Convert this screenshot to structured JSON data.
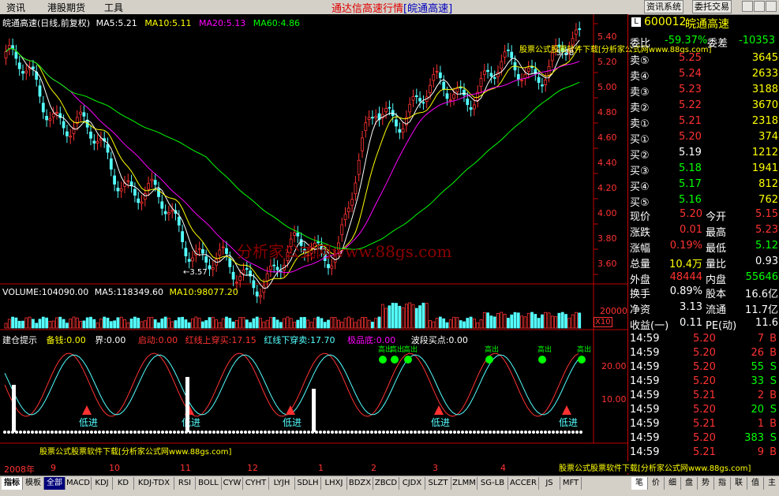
{
  "topbar": {
    "menu": [
      "资讯",
      "港股期货",
      "工具"
    ],
    "title": "通达信高速行情",
    "title_tag": "[皖通高速]",
    "buttons": [
      "资讯系统",
      "委托交易"
    ]
  },
  "main_header": {
    "stock": "皖通高速(日线,前复权)",
    "ma5": "MA5:5.21",
    "ma10": "MA10:5.11",
    "ma20": "MA20:5.13",
    "ma60": "MA60:4.86"
  },
  "price_axis": [
    "5.40",
    "5.20",
    "5.00",
    "4.80",
    "4.60",
    "4.40",
    "4.20",
    "4.00",
    "3.80",
    "3.60"
  ],
  "low_marker": "3.57",
  "high_marker": "5.38",
  "watermark": "分析家公式网www.88gs.com",
  "volume_header": {
    "vol": "VOLUME:104090.00",
    "ma5": "MA5:118349.60",
    "ma10": "MA10:98077.20"
  },
  "volume_axis": [
    "20000",
    "X10"
  ],
  "indicator_header": {
    "label": "建仓提示",
    "beicang": "备钱:0.00",
    "jie": "界:0.00",
    "qidong": "启动:0.00",
    "red_up": "红线上穿买:17.15",
    "red_down": "红线下穿卖:17.70",
    "bottom": "极品底:0.00",
    "wave": "波段买点:0.00"
  },
  "indicator_axis": [
    "20.00",
    "10.00"
  ],
  "indicator_labels": {
    "low_entry": "低进",
    "high_exit": "高出"
  },
  "ad_text_top": "股票公式股票软件下载[分析家公式网www.88gs.com]",
  "ad_text_bottom": "股票公式股票软件下载[分析家公式网www.88gs.com]",
  "ad_text_right": "股票公式股票软件下载[分析家公式网www.88gs.com]",
  "time_axis": [
    "2008年",
    "9",
    "10",
    "11",
    "12",
    "1",
    "2",
    "3",
    "4"
  ],
  "quote": {
    "code": "600012",
    "name": "皖通高速",
    "ratio_label": "委比",
    "ratio_value": "-59.37%",
    "diff_label": "委差",
    "diff_value": "-10353",
    "asks": [
      {
        "label": "卖⑤",
        "price": "5.25",
        "vol": "3645"
      },
      {
        "label": "卖④",
        "price": "5.24",
        "vol": "2633"
      },
      {
        "label": "卖③",
        "price": "5.23",
        "vol": "3188"
      },
      {
        "label": "卖②",
        "price": "5.22",
        "vol": "3670"
      },
      {
        "label": "卖①",
        "price": "5.21",
        "vol": "2318"
      }
    ],
    "bids": [
      {
        "label": "买①",
        "price": "5.20",
        "vol": "374"
      },
      {
        "label": "买②",
        "price": "5.19",
        "vol": "1212"
      },
      {
        "label": "买③",
        "price": "5.18",
        "vol": "1941"
      },
      {
        "label": "买④",
        "price": "5.17",
        "vol": "812"
      },
      {
        "label": "买⑤",
        "price": "5.16",
        "vol": "762"
      }
    ],
    "stats": [
      {
        "l1": "现价",
        "v1": "5.20",
        "l2": "今开",
        "v2": "5.15"
      },
      {
        "l1": "涨跌",
        "v1": "0.01",
        "l2": "最高",
        "v2": "5.23"
      },
      {
        "l1": "涨幅",
        "v1": "0.19%",
        "l2": "最低",
        "v2": "5.12"
      },
      {
        "l1": "总量",
        "v1": "10.4万",
        "l2": "量比",
        "v2": "0.93"
      },
      {
        "l1": "外盘",
        "v1": "48444",
        "l2": "内盘",
        "v2": "55646"
      }
    ],
    "fund": [
      {
        "l1": "换手",
        "v1": "0.89%",
        "l2": "股本",
        "v2": "16.6亿"
      },
      {
        "l1": "净资",
        "v1": "3.13",
        "l2": "流通",
        "v2": "11.7亿"
      },
      {
        "l1": "收益(一)",
        "v1": "0.11",
        "l2": "PE(动)",
        "v2": "11.6"
      }
    ],
    "ticks": [
      {
        "t": "14:59",
        "p": "5.20",
        "v": "7",
        "d": "B"
      },
      {
        "t": "14:59",
        "p": "5.20",
        "v": "26",
        "d": "B"
      },
      {
        "t": "14:59",
        "p": "5.20",
        "v": "55",
        "d": "S"
      },
      {
        "t": "14:59",
        "p": "5.20",
        "v": "33",
        "d": "S"
      },
      {
        "t": "14:59",
        "p": "5.21",
        "v": "2",
        "d": "B"
      },
      {
        "t": "14:59",
        "p": "5.20",
        "v": "20",
        "d": "S"
      },
      {
        "t": "14:59",
        "p": "5.21",
        "v": "1",
        "d": "B"
      },
      {
        "t": "14:59",
        "p": "5.20",
        "v": "383",
        "d": "S"
      },
      {
        "t": "14:59",
        "p": "5.21",
        "v": "9",
        "d": "B"
      }
    ],
    "ticks_last": "14:59"
  },
  "bottom_tabs": [
    "指标",
    "模板",
    "全部",
    "MACD",
    "KDJ",
    "KD",
    "KDJ-TDX",
    "RSI",
    "BOLL",
    "CYW",
    "CYHT",
    "LYJH",
    "SDLH",
    "LHXJ",
    "BDZX",
    "ZBCD",
    "CJDX",
    "SLZT",
    "ZLMM",
    "SG-LB",
    "ACCER",
    "JS",
    "MFT"
  ],
  "right_tabs": [
    "笔",
    "价",
    "细",
    "盘",
    "势",
    "指",
    "联",
    "值",
    "主"
  ],
  "colors": {
    "up": "#ff3232",
    "down": "#54ffff",
    "ma5": "#ffffff",
    "ma10": "#ffff00",
    "ma20": "#ff00ff",
    "ma60": "#00ff00"
  }
}
